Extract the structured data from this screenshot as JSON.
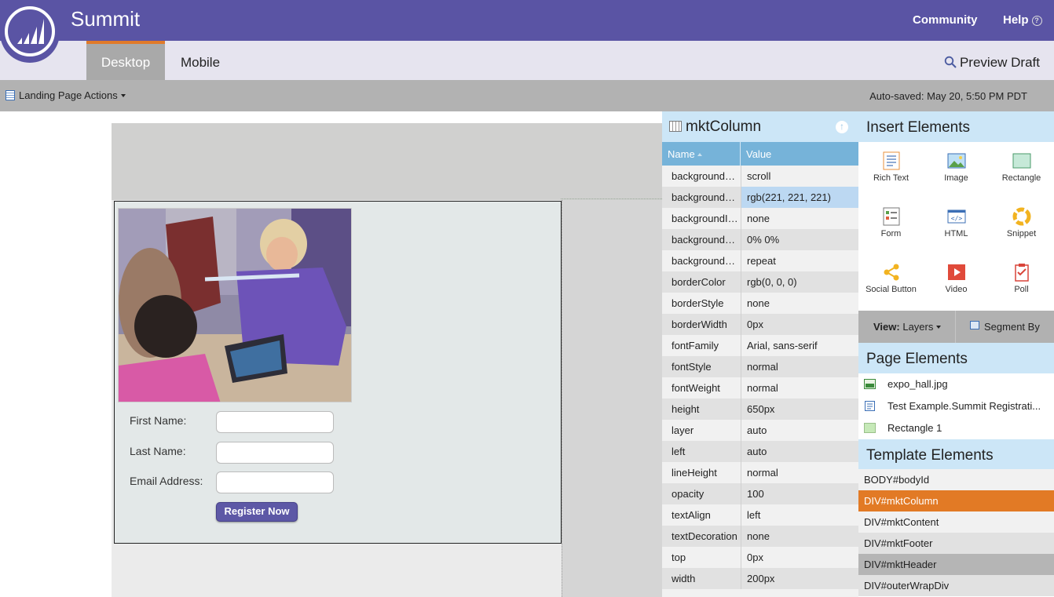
{
  "header": {
    "app_title": "Summit",
    "links": {
      "community": "Community",
      "help": "Help",
      "help_icon": "?"
    },
    "brand_color": "#5a54a4"
  },
  "tabs": [
    {
      "label": "Desktop",
      "active": true
    },
    {
      "label": "Mobile",
      "active": false
    }
  ],
  "preview_label": "Preview Draft",
  "toolbar": {
    "actions_label": "Landing Page Actions",
    "autosaved": "Auto-saved: May 20, 5:50 PM PDT"
  },
  "form": {
    "first_name_label": "First Name:",
    "last_name_label": "Last Name:",
    "email_label": "Email Address:",
    "first_name_value": "",
    "last_name_value": "",
    "email_value": "",
    "register_label": "Register Now"
  },
  "properties": {
    "title": "mktColumn",
    "up_icon": "↑",
    "columns": {
      "name": "Name",
      "value": "Value"
    },
    "rows": [
      {
        "name": "backgroundAttachment",
        "value": "scroll"
      },
      {
        "name": "backgroundColor",
        "value": "rgb(221, 221, 221)",
        "selected": true
      },
      {
        "name": "backgroundImage",
        "value": "none"
      },
      {
        "name": "backgroundPosition",
        "value": "0% 0%"
      },
      {
        "name": "backgroundRepeat",
        "value": "repeat"
      },
      {
        "name": "borderColor",
        "value": "rgb(0, 0, 0)"
      },
      {
        "name": "borderStyle",
        "value": "none"
      },
      {
        "name": "borderWidth",
        "value": "0px"
      },
      {
        "name": "fontFamily",
        "value": "Arial, sans-serif"
      },
      {
        "name": "fontStyle",
        "value": "normal"
      },
      {
        "name": "fontWeight",
        "value": "normal"
      },
      {
        "name": "height",
        "value": "650px"
      },
      {
        "name": "layer",
        "value": "auto"
      },
      {
        "name": "left",
        "value": "auto"
      },
      {
        "name": "lineHeight",
        "value": "normal"
      },
      {
        "name": "opacity",
        "value": "100"
      },
      {
        "name": "textAlign",
        "value": "left"
      },
      {
        "name": "textDecoration",
        "value": "none"
      },
      {
        "name": "top",
        "value": "0px"
      },
      {
        "name": "width",
        "value": "200px"
      }
    ]
  },
  "insert_elements": {
    "title": "Insert Elements",
    "items": [
      {
        "label": "Rich Text",
        "icon": "rich-text-icon"
      },
      {
        "label": "Image",
        "icon": "image-icon"
      },
      {
        "label": "Rectangle",
        "icon": "rectangle-icon"
      },
      {
        "label": "Form",
        "icon": "form-icon"
      },
      {
        "label": "HTML",
        "icon": "html-icon"
      },
      {
        "label": "Snippet",
        "icon": "snippet-icon"
      },
      {
        "label": "Social Button",
        "icon": "social-button-icon"
      },
      {
        "label": "Video",
        "icon": "video-icon"
      },
      {
        "label": "Poll",
        "icon": "poll-icon"
      }
    ]
  },
  "view_bar": {
    "view_prefix": "View:",
    "view_value": "Layers",
    "segment_label": "Segment By"
  },
  "page_elements": {
    "title": "Page Elements",
    "items": [
      {
        "label": "expo_hall.jpg",
        "icon": "image-icon"
      },
      {
        "label": "Test Example.Summit Registrati...",
        "icon": "rich-text-icon"
      },
      {
        "label": "Rectangle 1",
        "icon": "rectangle-icon"
      }
    ]
  },
  "template_elements": {
    "title": "Template Elements",
    "items": [
      {
        "label": "BODY#bodyId"
      },
      {
        "label": "DIV#mktColumn",
        "selected": true
      },
      {
        "label": "DIV#mktContent"
      },
      {
        "label": "DIV#mktFooter"
      },
      {
        "label": "DIV#mktHeader",
        "hover": true
      },
      {
        "label": "DIV#outerWrapDiv"
      }
    ]
  },
  "colors": {
    "accent_orange": "#e27a25",
    "panel_blue": "#cce6f7",
    "header_blue": "#76b3d9",
    "register_button": "#5d58a6"
  }
}
